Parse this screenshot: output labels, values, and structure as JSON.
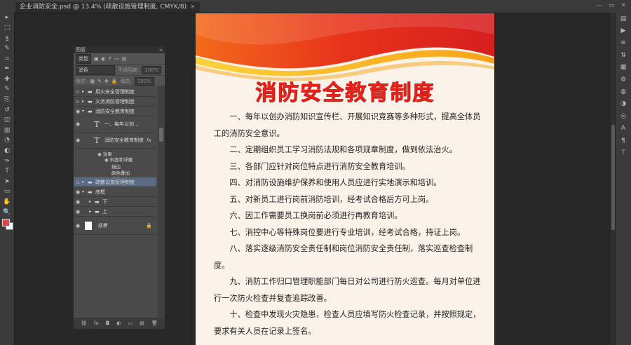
{
  "document_tab": {
    "title": "企业消防安全.psd @ 13.4% (疏散设施管理制度, CMYK/8)",
    "close": "×"
  },
  "window_controls": "— ▭ ✕",
  "toolbar": {
    "icons": [
      "move-icon",
      "marquee-icon",
      "lasso-icon",
      "quick-select-icon",
      "crop-icon",
      "eyedropper-icon",
      "healing-icon",
      "brush-icon",
      "stamp-icon",
      "history-brush-icon",
      "eraser-icon",
      "gradient-icon",
      "blur-icon",
      "dodge-icon",
      "pen-icon",
      "type-icon",
      "path-select-icon",
      "shape-icon",
      "hand-icon",
      "zoom-icon"
    ],
    "glyphs": [
      "▸",
      "⬚",
      "ꝸ",
      "✎",
      "⌗",
      "✒",
      "✚",
      "✎",
      "⎘",
      "↺",
      "◫",
      "▥",
      "◔",
      "◐",
      "✑",
      "T",
      "➤",
      "▭",
      "✋",
      "🔍"
    ]
  },
  "right_dock": {
    "icons": [
      "history-icon",
      "actions-icon",
      "adjustments-icon",
      "properties-icon",
      "swatches-icon",
      "styles-icon",
      "layers-panel-icon",
      "channels-icon",
      "paths-icon",
      "character-icon",
      "paragraph-icon",
      "glyphs-icon"
    ],
    "glyphs": [
      "▤",
      "▶",
      "≡",
      "⇅",
      "▦",
      "⚙",
      "◍",
      "◑",
      "◎",
      "A",
      "¶",
      "⊤"
    ]
  },
  "document": {
    "title": "消防安全教育制度",
    "paragraphs": [
      "一、每年以创办消防知识宣传栏、开展知识竞赛等多种形式，提高全体员工的消防安全意识。",
      "二、定期组织员工学习消防法规和各项规章制度，做到依法治火。",
      "三、各部门应针对岗位特点进行消防安全教育培训。",
      "四、对消防设施维护保养和使用人员应进行实地演示和培训。",
      "五、对新员工进行岗前消防培训，经考试合格后方可上岗。",
      "六、因工作需要员工换岗前必须进行再教育培训。",
      "七、消控中心等特殊岗位要进行专业培训，经考试合格，持证上岗。",
      "八、落实逐级消防安全责任制和岗位消防安全责任制，落实巡查检查制度。",
      "九、消防工作归口管理职能部门每日对公司进行防火巡查。每月对单位进行一次防火检查并复查追踪改善。",
      "十、检查中发现火灾隐患，检查人员应填写防火检查记录，并按照规定，要求有关人员在记录上签名。"
    ]
  },
  "layers_panel": {
    "title": "图层",
    "filter_kind": "类型",
    "blend_mode": "滤色",
    "opacity_label": "不透明度:",
    "opacity_value": "100%",
    "lock_label": "锁定:",
    "fill_label": "填充:",
    "fill_value": "100%",
    "layers": [
      {
        "name": "用火安全管理制度",
        "kind": "group",
        "visible": false
      },
      {
        "name": "义务消防管理制度",
        "kind": "group",
        "visible": false
      },
      {
        "name": "消防安全教育制度",
        "kind": "group-open",
        "visible": true
      },
      {
        "name": "一、每年以创...",
        "kind": "text",
        "visible": true
      },
      {
        "name": "消防安全教育制度",
        "kind": "text",
        "visible": true,
        "fx": "fx"
      },
      {
        "name": "疏散设施管理制度",
        "kind": "group",
        "visible": false,
        "selected": true
      },
      {
        "name": "底框",
        "kind": "group-open",
        "visible": true
      },
      {
        "name": "下",
        "kind": "group",
        "visible": true
      },
      {
        "name": "上",
        "kind": "group",
        "visible": true
      },
      {
        "name": "背景",
        "kind": "background",
        "visible": true
      }
    ],
    "effects_label": "效果",
    "effects": [
      "斜面和浮雕",
      "描边",
      "颜色叠加",
      "投影"
    ],
    "footer_icons": [
      "⛓",
      "fx",
      "◘",
      "◐",
      "▭",
      "▤",
      "🗑"
    ]
  },
  "colors": {
    "title_red": "#e8231b",
    "foreground": "#d84a4a",
    "background": "#ffffff",
    "selection": "#5a6b86"
  }
}
